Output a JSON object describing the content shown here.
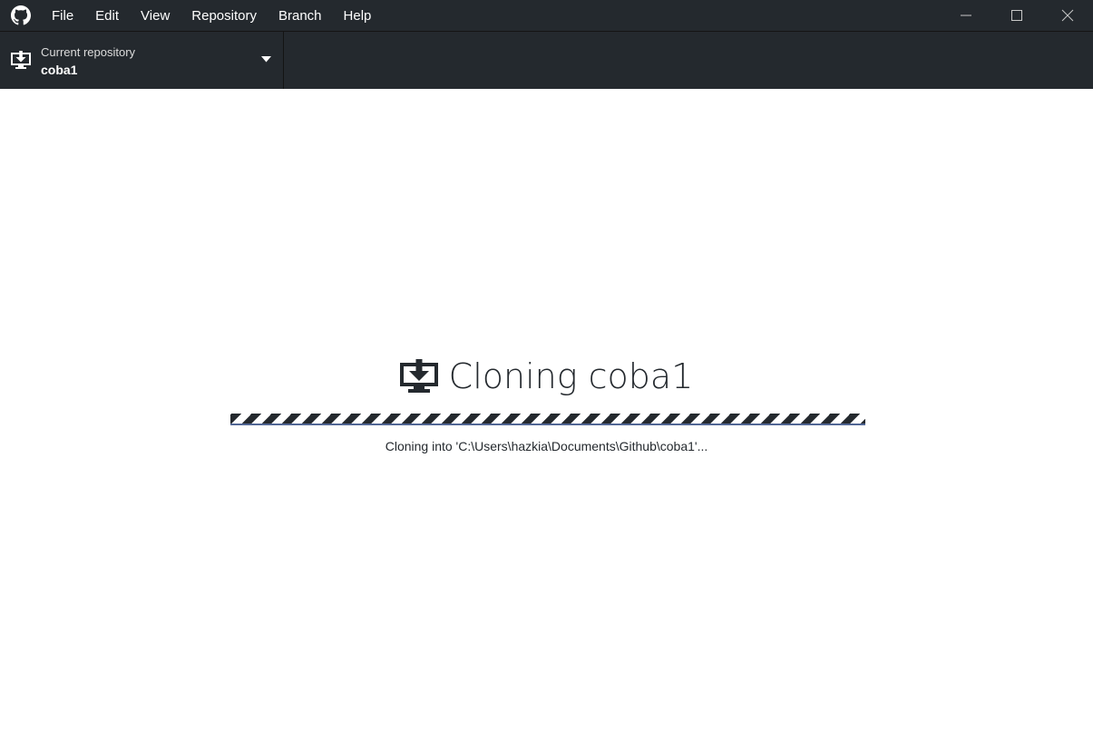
{
  "menu": {
    "items": [
      {
        "label": "File"
      },
      {
        "label": "Edit"
      },
      {
        "label": "View"
      },
      {
        "label": "Repository"
      },
      {
        "label": "Branch"
      },
      {
        "label": "Help"
      }
    ]
  },
  "window_controls": {
    "minimize_icon": "minimize-icon",
    "maximize_icon": "maximize-icon",
    "close_icon": "close-icon"
  },
  "toolbar": {
    "repository": {
      "caption": "Current repository",
      "name": "coba1",
      "icon": "clone-download-icon"
    }
  },
  "clone": {
    "title": "Cloning coba1",
    "status": "Cloning into 'C:\\Users\\hazkia\\Documents\\Github\\coba1'...",
    "progress": "indeterminate"
  },
  "colors": {
    "chrome": "#24292e",
    "text": "#ffffff",
    "background": "#ffffff"
  }
}
